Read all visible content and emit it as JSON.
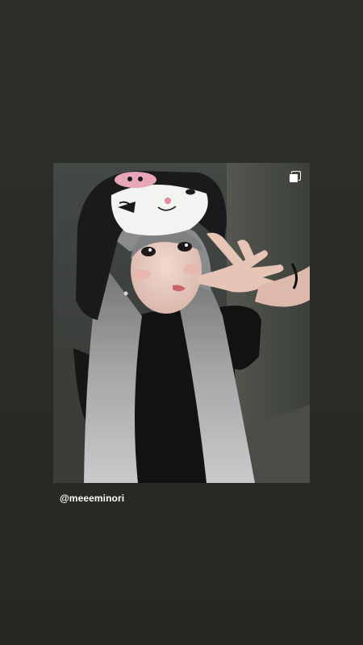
{
  "story": {
    "background_color": "#2a2c27",
    "shared_post": {
      "multiple_items_icon": "multiple-photos-icon",
      "photo_subject": "selfie"
    },
    "mention_label": "@meeeminori"
  }
}
